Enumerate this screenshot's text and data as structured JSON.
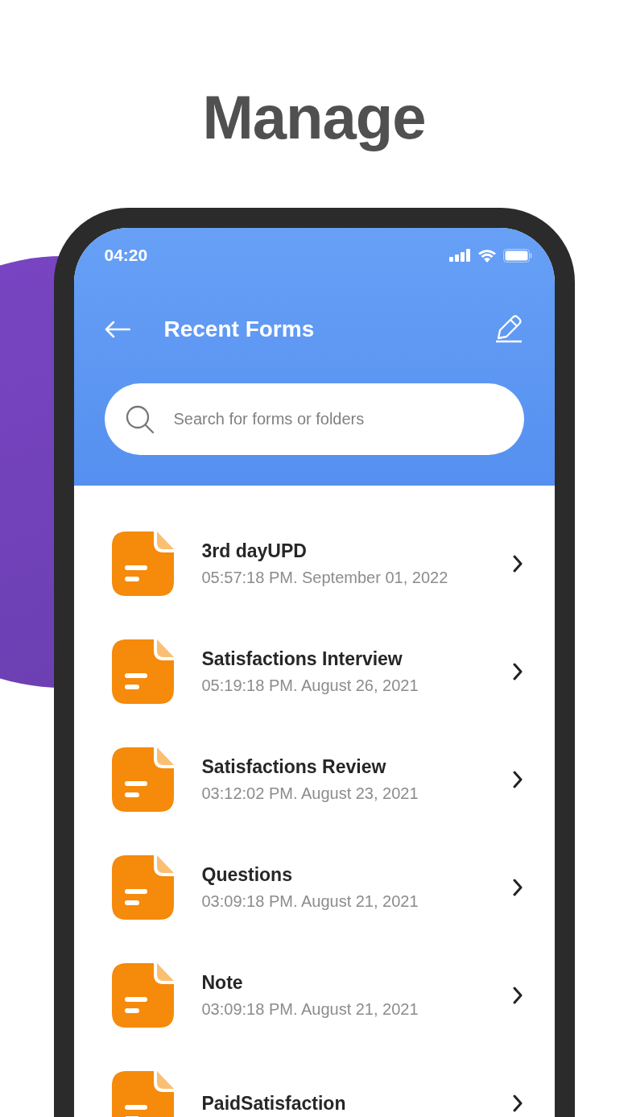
{
  "headline": "Manage",
  "status_bar": {
    "time": "04:20"
  },
  "header": {
    "title": "Recent Forms"
  },
  "search": {
    "placeholder": "Search for forms or folders"
  },
  "forms": [
    {
      "title": "3rd dayUPD",
      "date": "05:57:18 PM. September 01, 2022"
    },
    {
      "title": "Satisfactions Interview",
      "date": "05:19:18 PM. August 26, 2021"
    },
    {
      "title": "Satisfactions Review",
      "date": "03:12:02 PM. August 23, 2021"
    },
    {
      "title": "Questions",
      "date": "03:09:18 PM. August 21, 2021"
    },
    {
      "title": "Note",
      "date": "03:09:18 PM. August 21, 2021"
    },
    {
      "title": "PaidSatisfaction"
    }
  ]
}
